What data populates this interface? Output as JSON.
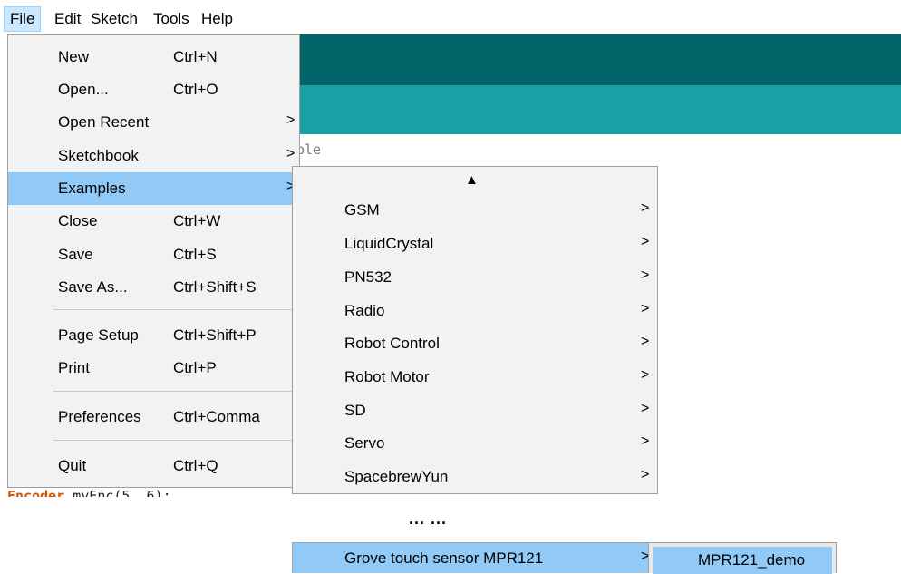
{
  "menubar": [
    "File",
    "Edit",
    "Sketch",
    "Tools",
    "Help"
  ],
  "file_menu": {
    "items": [
      {
        "label": "New",
        "shortcut": "Ctrl+N"
      },
      {
        "label": "Open...",
        "shortcut": "Ctrl+O"
      },
      {
        "label": "Open Recent",
        "submenu": ">"
      },
      {
        "label": "Sketchbook",
        "submenu": ">"
      },
      {
        "label": "Examples",
        "submenu": ">"
      },
      {
        "label": "Close",
        "shortcut": "Ctrl+W"
      },
      {
        "label": "Save",
        "shortcut": "Ctrl+S"
      },
      {
        "label": "Save As...",
        "shortcut": "Ctrl+Shift+S"
      },
      {
        "label": "Page Setup",
        "shortcut": "Ctrl+Shift+P"
      },
      {
        "label": "Print",
        "shortcut": "Ctrl+P"
      },
      {
        "label": "Preferences",
        "shortcut": "Ctrl+Comma"
      },
      {
        "label": "Quit",
        "shortcut": "Ctrl+Q"
      }
    ]
  },
  "examples_menu": {
    "scroll_up": "▲",
    "items": [
      "GSM",
      "LiquidCrystal",
      "PN532",
      "Radio",
      "Robot Control",
      "Robot Motor",
      "SD",
      "Servo",
      "SpacebrewYun"
    ],
    "arrow": ">"
  },
  "ellipsis": "... ...",
  "grove_item": {
    "label": "Grove touch sensor MPR121",
    "arrow": ">"
  },
  "demo_item": {
    "label": "MPR121_demo"
  },
  "code_fragment": "ple",
  "code_bottom": {
    "keyword": "Encoder",
    "rest": " myEnc(5, 6);"
  },
  "colors": {
    "toolbar_dark": "#006468",
    "toolbar_teal": "#17a1a5",
    "highlight": "#91c9f7"
  }
}
